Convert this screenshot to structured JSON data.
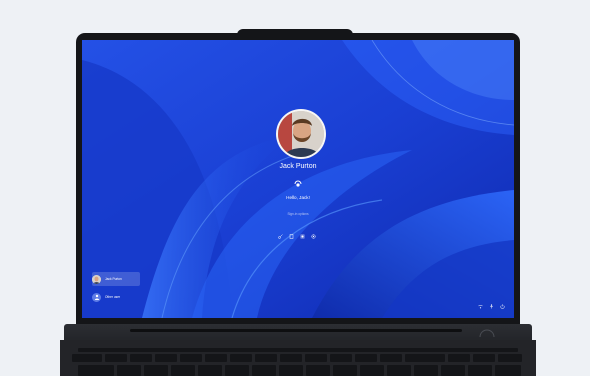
{
  "lock_screen": {
    "user_name": "Jack Purton",
    "greeting": "Hello, Jack!",
    "sign_in_options_label": "Sign-in options",
    "sign_in_icons": [
      "key-icon",
      "pin-icon",
      "face-icon",
      "fingerprint-icon"
    ],
    "accounts": [
      {
        "name": "Jack Purton",
        "selected": true
      },
      {
        "name": "Other user",
        "selected": false
      }
    ],
    "system_icons": [
      "network-icon",
      "accessibility-icon",
      "power-icon"
    ]
  },
  "colors": {
    "wallpaper_blue": "#1b43d8",
    "bezel": "#141518",
    "keyboard_deck": "#232428"
  }
}
